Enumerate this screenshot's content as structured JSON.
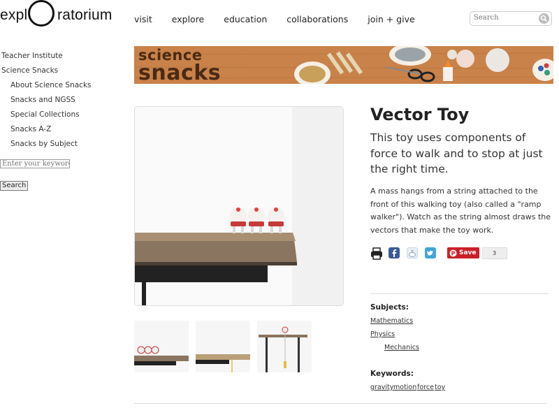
{
  "header": {
    "logo_left": "expl",
    "logo_right": "ratorium",
    "nav": [
      "visit",
      "explore",
      "education",
      "collaborations",
      "join + give"
    ],
    "search_placeholder": "Search"
  },
  "sidebar": {
    "items": [
      {
        "label": "Teacher Institute",
        "level": 0
      },
      {
        "label": "Science Snacks",
        "level": 0
      },
      {
        "label": "About Science Snacks",
        "level": 1
      },
      {
        "label": "Snacks and NGSS",
        "level": 1
      },
      {
        "label": "Special Collections",
        "level": 1
      },
      {
        "label": "Snacks A-Z",
        "level": 1
      },
      {
        "label": "Snacks by Subject",
        "level": 1
      }
    ],
    "keyword_placeholder": "Enter your keywords",
    "search_button": "Search"
  },
  "banner": {
    "line1": "science",
    "line2": "snacks"
  },
  "product": {
    "title": "Vector Toy",
    "lead": "This toy uses components of force to walk and to stop at just the right time.",
    "description": "A mass hangs from a string attached to the front of this walking toy (also called a \"ramp walker\"). Watch as the string almost draws the vectors that make the toy work.",
    "pinterest_label": "Save",
    "pinterest_count": "3"
  },
  "subjects": {
    "label": "Subjects:",
    "items": [
      "Mathematics",
      "Physics",
      "Mechanics"
    ]
  },
  "keywords": {
    "label": "Keywords:",
    "items": [
      "gravity",
      "motion",
      "force",
      "toy"
    ]
  },
  "colors": {
    "banner": "#c97c45",
    "pinterest": "#cb2027",
    "facebook": "#3b5998",
    "twitter": "#3fa7d6"
  }
}
